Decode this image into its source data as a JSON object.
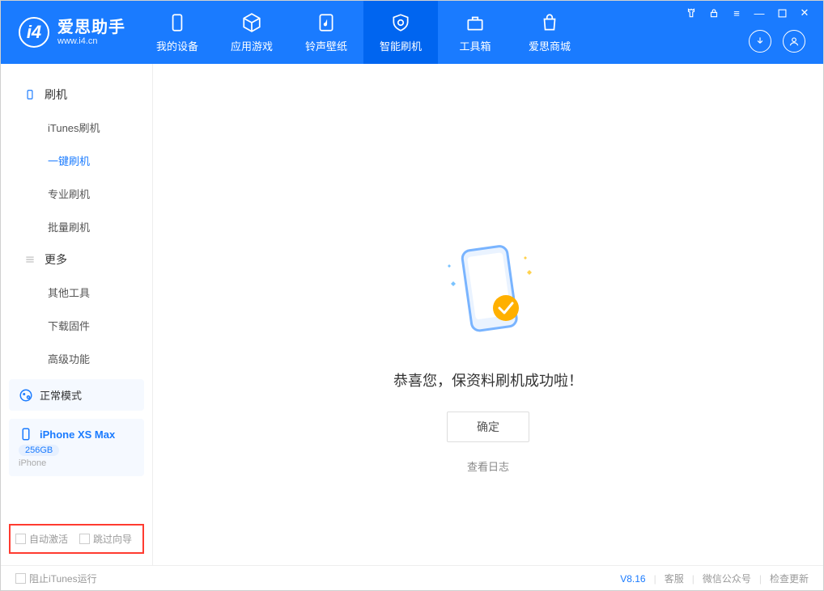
{
  "app": {
    "name_cn": "爱思助手",
    "name_en": "www.i4.cn"
  },
  "nav": {
    "items": [
      {
        "label": "我的设备"
      },
      {
        "label": "应用游戏"
      },
      {
        "label": "铃声壁纸"
      },
      {
        "label": "智能刷机"
      },
      {
        "label": "工具箱"
      },
      {
        "label": "爱思商城"
      }
    ]
  },
  "sidebar": {
    "group1": {
      "title": "刷机"
    },
    "items1": [
      {
        "label": "iTunes刷机"
      },
      {
        "label": "一键刷机"
      },
      {
        "label": "专业刷机"
      },
      {
        "label": "批量刷机"
      }
    ],
    "group2": {
      "title": "更多"
    },
    "items2": [
      {
        "label": "其他工具"
      },
      {
        "label": "下载固件"
      },
      {
        "label": "高级功能"
      }
    ],
    "mode_label": "正常模式",
    "device": {
      "name": "iPhone XS Max",
      "storage": "256GB",
      "type": "iPhone"
    },
    "opt_auto_activate": "自动激活",
    "opt_skip_guide": "跳过向导"
  },
  "main": {
    "success_title": "恭喜您，保资料刷机成功啦！",
    "ok_label": "确定",
    "view_log": "查看日志"
  },
  "footer": {
    "block_itunes": "阻止iTunes运行",
    "version": "V8.16",
    "support": "客服",
    "wechat": "微信公众号",
    "check_update": "检查更新"
  }
}
